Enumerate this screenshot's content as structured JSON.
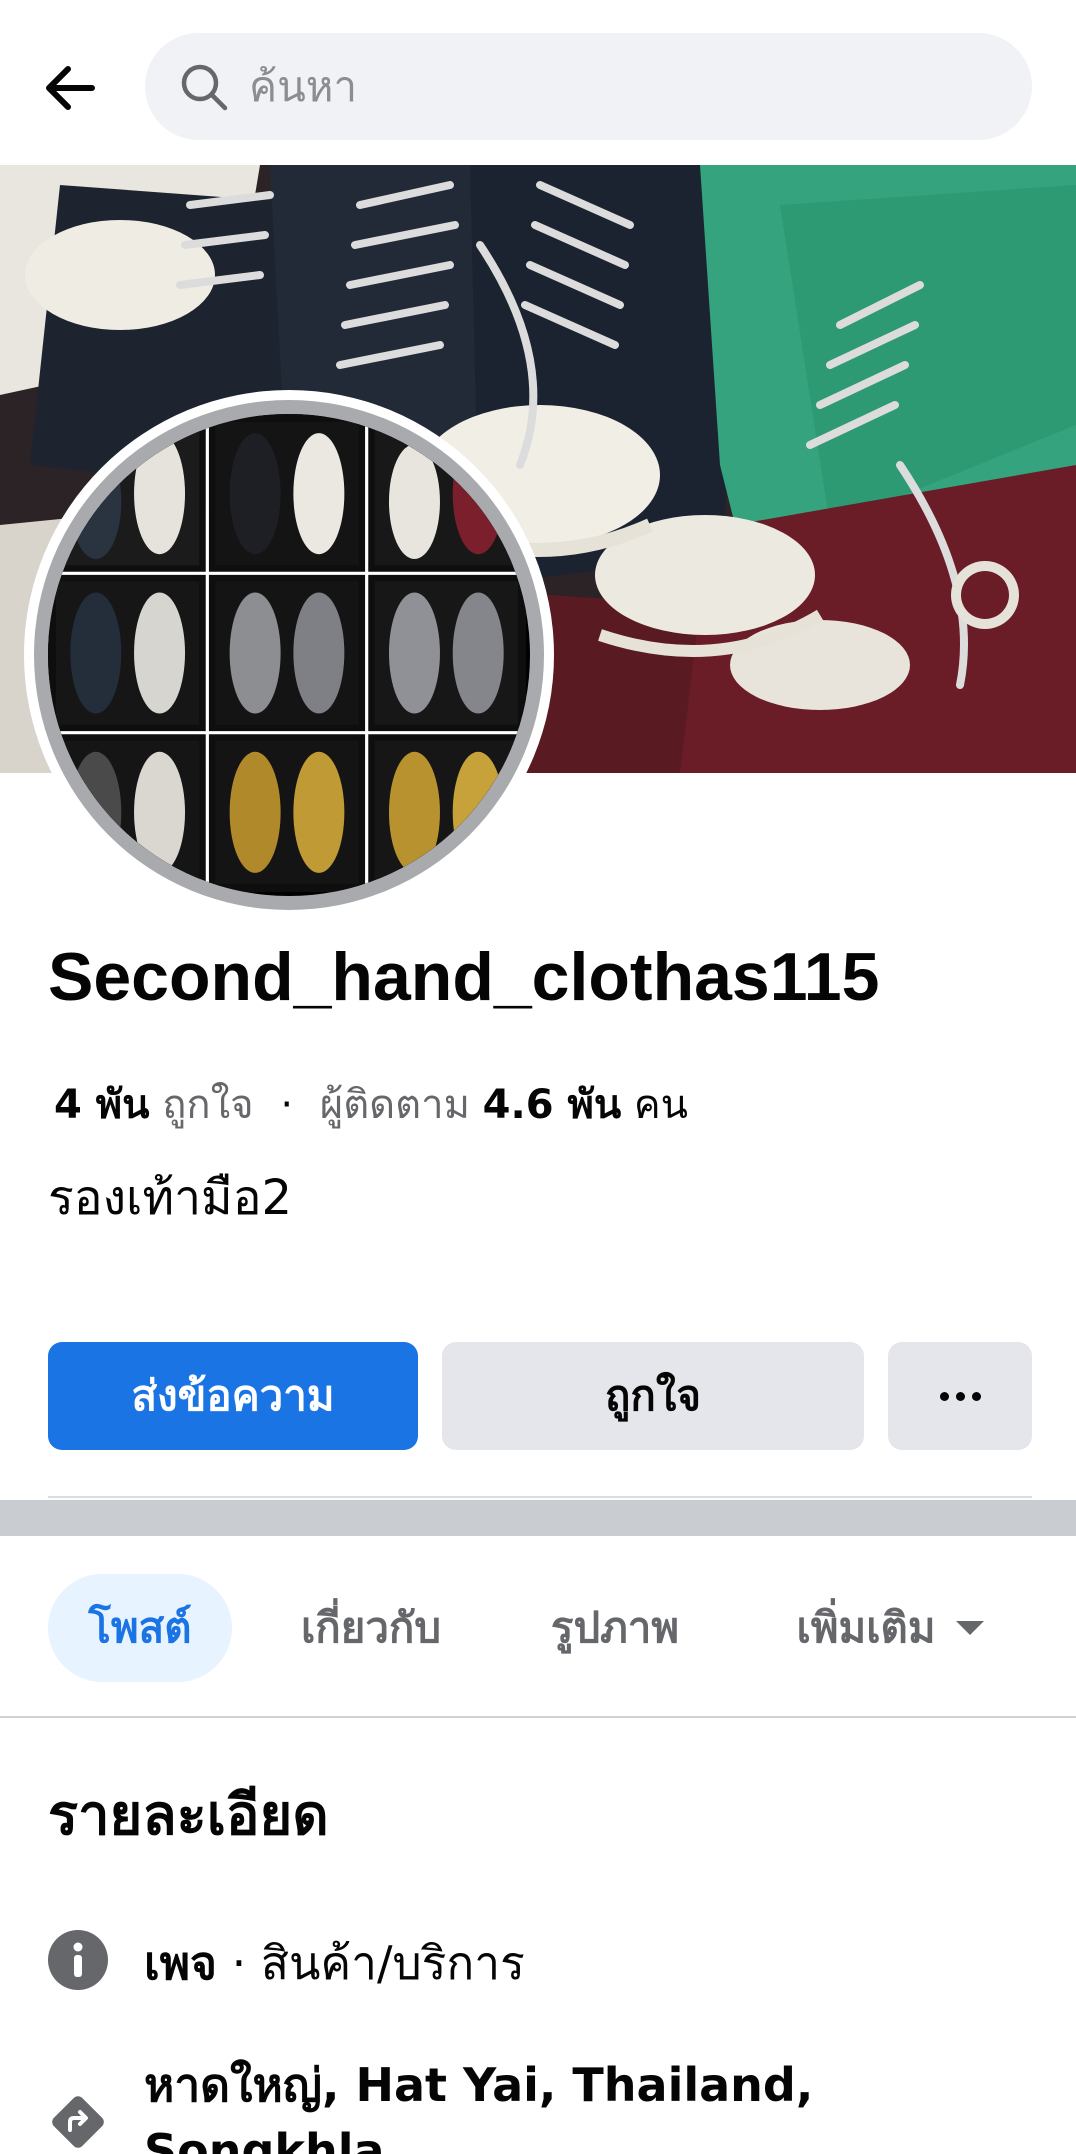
{
  "search": {
    "placeholder": "ค้นหา"
  },
  "icons": {
    "back": "back-arrow-icon",
    "search": "search-icon",
    "info": "info-icon",
    "directions": "directions-icon",
    "more": "more-dots-icon",
    "caret": "caret-down-icon"
  },
  "colors": {
    "primary": "#1b74e4",
    "secondary_button": "#e4e6eb",
    "active_tab_bg": "#e7f3ff",
    "muted_text": "#65676b"
  },
  "page": {
    "name": "Second_hand_clothas115",
    "likes_count": "4 พัน",
    "likes_label": "ถูกใจ",
    "separator": "·",
    "followers_label": "ผู้ติดตาม",
    "followers_count": "4.6 พัน",
    "followers_unit": "คน",
    "description": "รองเท้ามือ2"
  },
  "actions": {
    "message_label": "ส่งข้อความ",
    "like_label": "ถูกใจ"
  },
  "tabs": [
    {
      "label": "โพสต์",
      "active": true
    },
    {
      "label": "เกี่ยวกับ",
      "active": false
    },
    {
      "label": "รูปภาพ",
      "active": false
    },
    {
      "label": "เพิ่มเติม",
      "active": false
    }
  ],
  "details": {
    "title": "รายละเอียด",
    "type_bold": "เพจ",
    "type_text": " · สินค้า/บริการ",
    "address": "หาดใหญ่, Hat Yai, Thailand, Songkhla"
  }
}
